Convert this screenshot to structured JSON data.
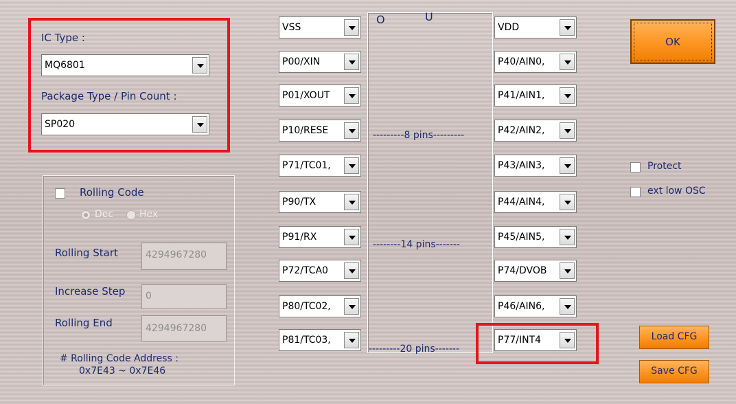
{
  "ic": {
    "type_label": "IC Type :",
    "type_value": "MQ6801",
    "package_label": "Package Type / Pin Count :",
    "package_value": "SP020"
  },
  "rolling": {
    "enable_label": "Rolling Code",
    "radio_dec": "Dec",
    "radio_hex": "Hex",
    "start_label": "Rolling Start",
    "start_value": "4294967280",
    "step_label": "Increase Step",
    "step_value": "0",
    "end_label": "Rolling End",
    "end_value": "4294967280",
    "address_label": "# Rolling Code Address :",
    "address_value": "0x7E43 ~ 0x7E46"
  },
  "chip": {
    "marker_left": "O",
    "marker_top": "U",
    "pins_8": "---------8 pins---------",
    "pins_14": "--------14 pins-------",
    "pins_20": "---------20 pins-------"
  },
  "left_pins": [
    "VSS",
    "P00/XIN",
    "P01/XOUT",
    "P10/RESE",
    "P71/TC01,",
    "P90/TX",
    "P91/RX",
    "P72/TCA0",
    "P80/TC02,",
    "P81/TC03,"
  ],
  "right_pins": [
    "VDD",
    "P40/AIN0,",
    "P41/AIN1,",
    "P42/AIN2,",
    "P43/AIN3,",
    "P44/AIN4,",
    "P45/AIN5,",
    "P74/DVOB",
    "P46/AIN6,",
    "P77/INT4"
  ],
  "options": {
    "protect_label": "Protect",
    "ext_osc_label": "ext low OSC"
  },
  "buttons": {
    "ok": "OK",
    "load_cfg": "Load CFG",
    "save_cfg": "Save CFG"
  },
  "colors": {
    "highlight": "#e8141b",
    "label_text": "#1b2a6e",
    "button_orange": "#ff9a2a"
  }
}
